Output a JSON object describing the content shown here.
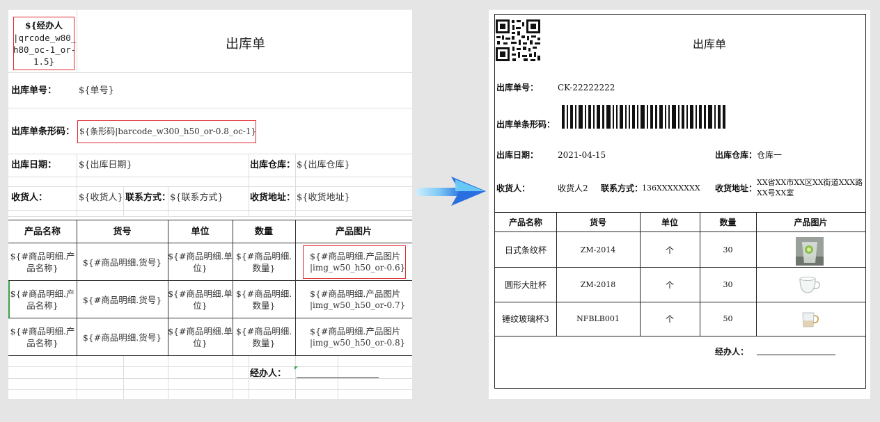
{
  "template": {
    "qr_placeholder": [
      "${经办人",
      "|qrcode_w80_",
      "h80_oc-1_or-",
      "1.5}"
    ],
    "title": "出库单",
    "order_no_label": "出库单号：",
    "order_no_value": "${单号}",
    "barcode_label": "出库单条形码：",
    "barcode_value": "${条形码|barcode_w300_h50_or-0.8_oc-1}",
    "date_label": "出库日期：",
    "date_value": "${出库日期}",
    "warehouse_label": "出库仓库：",
    "warehouse_value": "${出库仓库}",
    "receiver_label": "收货人：",
    "receiver_value": "${收货人}",
    "contact_label": "联系方式：",
    "contact_value": "${联系方式}",
    "address_label": "收货地址：",
    "address_value": "${收货地址}",
    "headers": [
      "产品名称",
      "货号",
      "单位",
      "数量",
      "产品图片"
    ],
    "rows": [
      {
        "name": [
          "${#商品明细.产",
          "品名称}"
        ],
        "code": "${#商品明细.货号}",
        "unit": [
          "${#商品明细.单",
          "位}"
        ],
        "qty": [
          "${#商品明细.",
          "数量}"
        ],
        "img": [
          "${#商品明细.产品图片",
          "|img_w50_h50_or-0.6}"
        ]
      },
      {
        "name": [
          "${#商品明细.产",
          "品名称}"
        ],
        "code": "${#商品明细.货号}",
        "unit": [
          "${#商品明细.单",
          "位}"
        ],
        "qty": [
          "${#商品明细.",
          "数量}"
        ],
        "img": [
          "${#商品明细.产品图片",
          "|img_w50_h50_or-0.7}"
        ]
      },
      {
        "name": [
          "${#商品明细.产",
          "品名称}"
        ],
        "code": "${#商品明细.货号}",
        "unit": [
          "${#商品明细.单",
          "位}"
        ],
        "qty": [
          "${#商品明细.",
          "数量}"
        ],
        "img": [
          "${#商品明细.产品图片",
          "|img_w50_h50_or-0.8}"
        ]
      }
    ],
    "handler_label": "经办人："
  },
  "output": {
    "title": "出库单",
    "order_no_label": "出库单号：",
    "order_no_value": "CK-22222222",
    "barcode_label": "出库单条形码：",
    "date_label": "出库日期：",
    "date_value": "2021-04-15",
    "warehouse_label": "出库仓库：",
    "warehouse_value": "仓库一",
    "receiver_label": "收货人：",
    "receiver_value": "收货人2",
    "contact_label": "联系方式：",
    "contact_value": "136XXXXXXXX",
    "address_label": "收货地址：",
    "address_value": [
      "XX省XX市XX区XX街道XXX路",
      "XX号XX室"
    ],
    "headers": [
      "产品名称",
      "货号",
      "单位",
      "数量",
      "产品图片"
    ],
    "rows": [
      {
        "name": "日式条纹杯",
        "code": "ZM-2014",
        "unit": "个",
        "qty": "30",
        "img": "glass-with-lime-photo"
      },
      {
        "name": "圆形大肚杯",
        "code": "ZM-2018",
        "unit": "个",
        "qty": "30",
        "img": "round-glass-mug-icon"
      },
      {
        "name": "锤纹玻璃杯3",
        "code": "NFBLB001",
        "unit": "个",
        "qty": "50",
        "img": "hammered-glass-cup-icon"
      }
    ],
    "handler_label": "经办人："
  },
  "colors": {
    "highlight_border": "#e0282e",
    "arrow_start": "#8ed8f8",
    "arrow_end": "#2a6fe0"
  }
}
